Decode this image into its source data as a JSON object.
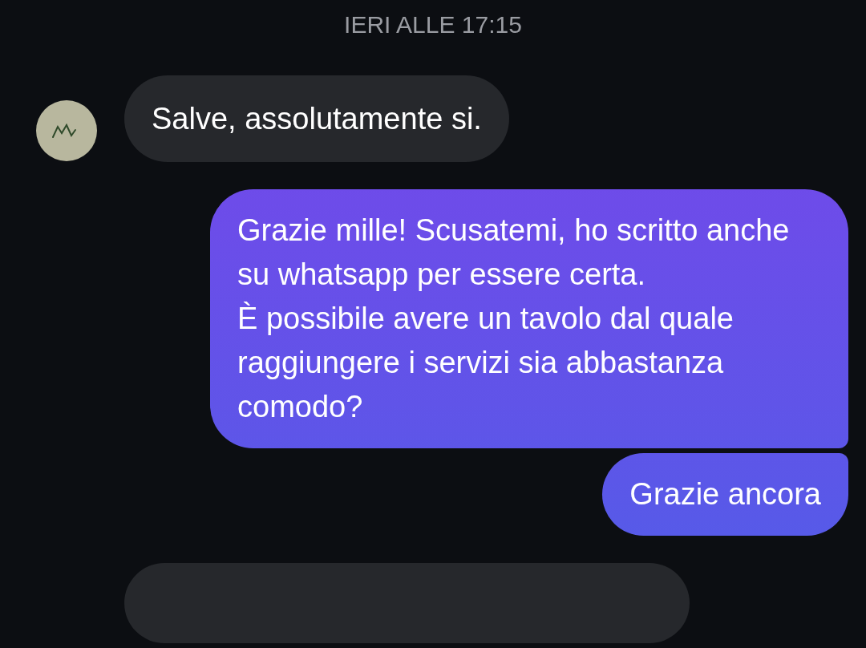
{
  "timestamp": "IERI ALLE 17:15",
  "messages": [
    {
      "kind": "received",
      "paragraphs": [
        "Salve, assolutamente si."
      ]
    },
    {
      "kind": "sent",
      "paragraphs": [
        "Grazie mille! Scusatemi, ho scritto anche su whatsapp per essere certa.",
        "È possibile avere un tavolo dal quale raggiungere i servizi sia abbastanza comodo?"
      ]
    },
    {
      "kind": "sent",
      "paragraphs": [
        "Grazie ancora"
      ]
    }
  ]
}
